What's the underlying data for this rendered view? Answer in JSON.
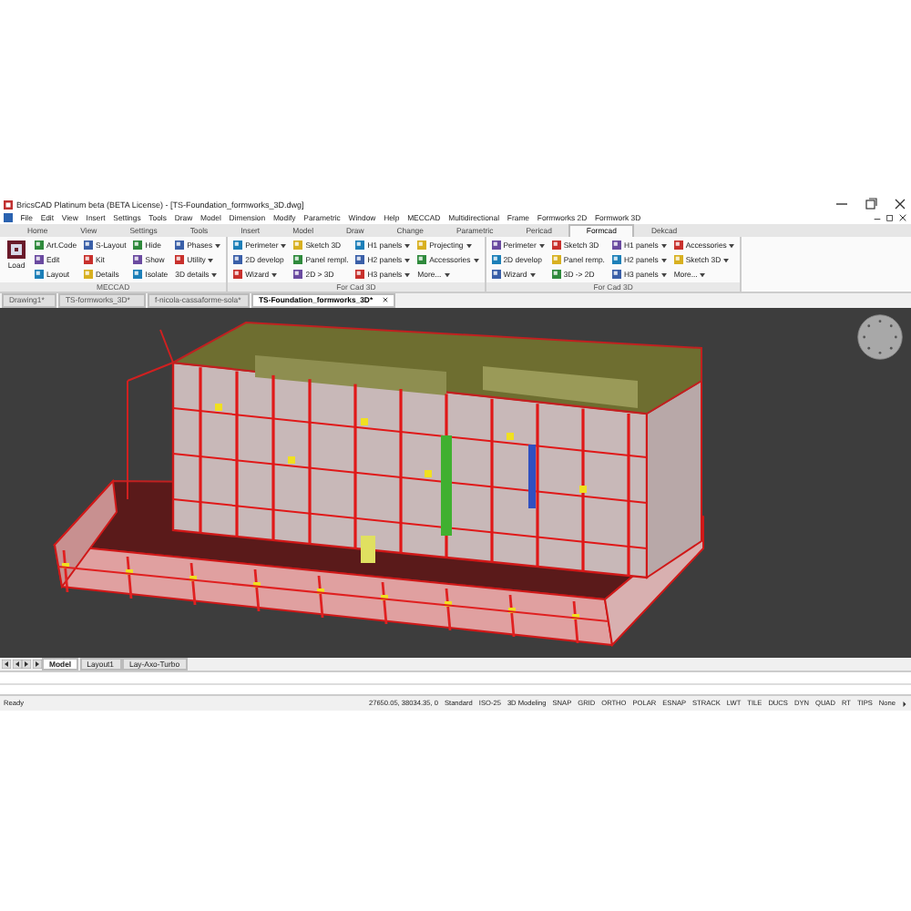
{
  "title_bar": {
    "title": "BricsCAD Platinum beta (BETA License) - [TS-Foundation_formworks_3D.dwg]"
  },
  "menu_bar": {
    "items": [
      "File",
      "Edit",
      "View",
      "Insert",
      "Settings",
      "Tools",
      "Draw",
      "Model",
      "Dimension",
      "Modify",
      "Parametric",
      "Window",
      "Help",
      "MECCAD",
      "Multidirectional",
      "Frame",
      "Formworks 2D",
      "Formwork 3D"
    ]
  },
  "ribbon": {
    "tabs": [
      {
        "label": "Home",
        "selected": false
      },
      {
        "label": "View",
        "selected": false
      },
      {
        "label": "Settings",
        "selected": false
      },
      {
        "label": "Tools",
        "selected": false
      },
      {
        "label": "Insert",
        "selected": false
      },
      {
        "label": "Model",
        "selected": false
      },
      {
        "label": "Draw",
        "selected": false
      },
      {
        "label": "Change",
        "selected": false
      },
      {
        "label": "Parametric",
        "selected": false
      },
      {
        "label": "Pericad",
        "selected": false
      },
      {
        "label": "Formcad",
        "selected": true
      },
      {
        "label": "Dekcad",
        "selected": false
      }
    ],
    "panels": [
      {
        "title": "MECCAD",
        "columns": [
          [
            {
              "kind": "large",
              "label": "Load",
              "dropdown": false
            }
          ],
          [
            {
              "kind": "small",
              "label": "Art.Code",
              "dropdown": false
            },
            {
              "kind": "small",
              "label": "Edit",
              "dropdown": false
            },
            {
              "kind": "small",
              "label": "Layout",
              "dropdown": false
            }
          ],
          [
            {
              "kind": "small",
              "label": "S-Layout",
              "dropdown": false
            },
            {
              "kind": "small",
              "label": "Kit",
              "dropdown": false
            },
            {
              "kind": "small",
              "label": "Details",
              "dropdown": false
            }
          ],
          [
            {
              "kind": "small",
              "label": "Hide",
              "dropdown": false
            },
            {
              "kind": "small",
              "label": "Show",
              "dropdown": false
            },
            {
              "kind": "small",
              "label": "Isolate",
              "dropdown": false
            }
          ],
          [
            {
              "kind": "small",
              "label": "Phases",
              "dropdown": true
            },
            {
              "kind": "small",
              "label": "Utility",
              "dropdown": true
            },
            {
              "kind": "text",
              "label": "3D details",
              "dropdown": true
            }
          ]
        ]
      },
      {
        "title": "For Cad 3D",
        "columns": [
          [
            {
              "kind": "small",
              "label": "Perimeter",
              "dropdown": true
            },
            {
              "kind": "small",
              "label": "2D develop",
              "dropdown": false
            },
            {
              "kind": "small",
              "label": "Wizard",
              "dropdown": true
            }
          ],
          [
            {
              "kind": "small",
              "label": "Sketch 3D",
              "dropdown": false
            },
            {
              "kind": "small",
              "label": "Panel rempl.",
              "dropdown": false
            },
            {
              "kind": "small",
              "label": "2D > 3D",
              "dropdown": false
            }
          ],
          [
            {
              "kind": "small",
              "label": "H1 panels",
              "dropdown": true
            },
            {
              "kind": "small",
              "label": "H2 panels",
              "dropdown": true
            },
            {
              "kind": "small",
              "label": "H3 panels",
              "dropdown": true
            }
          ],
          [
            {
              "kind": "small",
              "label": "Projecting",
              "dropdown": true
            },
            {
              "kind": "small",
              "label": "Accessories",
              "dropdown": true
            },
            {
              "kind": "text",
              "label": "More...",
              "dropdown": true
            }
          ]
        ]
      },
      {
        "title": "For Cad 3D",
        "columns": [
          [
            {
              "kind": "small",
              "label": "Perimeter",
              "dropdown": true
            },
            {
              "kind": "small",
              "label": "2D develop",
              "dropdown": false
            },
            {
              "kind": "small",
              "label": "Wizard",
              "dropdown": true
            }
          ],
          [
            {
              "kind": "small",
              "label": "Sketch 3D",
              "dropdown": false
            },
            {
              "kind": "small",
              "label": "Panel remp.",
              "dropdown": false
            },
            {
              "kind": "small",
              "label": "3D -> 2D",
              "dropdown": false
            }
          ],
          [
            {
              "kind": "small",
              "label": "H1 panels",
              "dropdown": true
            },
            {
              "kind": "small",
              "label": "H2 panels",
              "dropdown": true
            },
            {
              "kind": "small",
              "label": "H3 panels",
              "dropdown": true
            }
          ],
          [
            {
              "kind": "small",
              "label": "Accessories",
              "dropdown": true
            },
            {
              "kind": "small",
              "label": "Sketch 3D",
              "dropdown": true
            },
            {
              "kind": "text",
              "label": "More...",
              "dropdown": true
            }
          ]
        ]
      }
    ]
  },
  "document_tabs": [
    {
      "label": "Drawing1*",
      "selected": false
    },
    {
      "label": "TS-formworks_3D*",
      "selected": false
    },
    {
      "label": "f-nicola-cassaforme-sola*",
      "selected": false
    },
    {
      "label": "TS-Foundation_formworks_3D*",
      "selected": true
    }
  ],
  "layout_tabs": [
    {
      "label": "Model",
      "selected": true
    },
    {
      "label": "Layout1",
      "selected": false
    },
    {
      "label": "Lay-Axo-Turbo",
      "selected": false
    }
  ],
  "status_bar": {
    "status": "Ready",
    "coordinates": "27650.05, 38034.35, 0",
    "items": [
      "Standard",
      "ISO-25",
      "3D Modeling",
      "SNAP",
      "GRID",
      "ORTHO",
      "POLAR",
      "ESNAP",
      "STRACK",
      "LWT",
      "TILE",
      "DUCS",
      "DYN",
      "QUAD",
      "RT",
      "TIPS",
      "None"
    ]
  }
}
